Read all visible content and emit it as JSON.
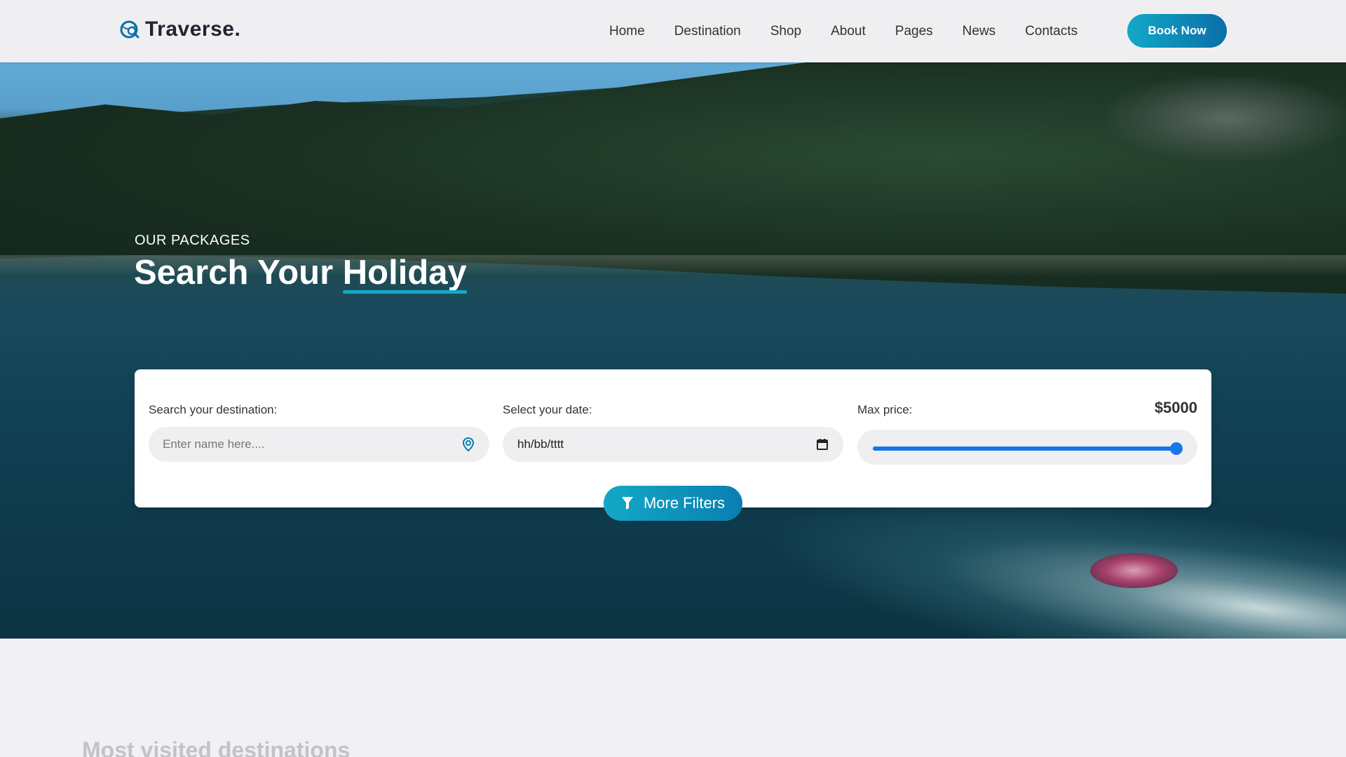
{
  "brand": {
    "name": "Traverse.",
    "icon": "globe-search-icon",
    "color": "#0a6fa9"
  },
  "nav": {
    "items": [
      {
        "label": "Home"
      },
      {
        "label": "Destination"
      },
      {
        "label": "Shop"
      },
      {
        "label": "About"
      },
      {
        "label": "Pages"
      },
      {
        "label": "News"
      },
      {
        "label": "Contacts"
      }
    ],
    "book_label": "Book Now"
  },
  "hero": {
    "eyebrow": "OUR PACKAGES",
    "title_prefix": "Search Your",
    "title_highlight": "Holiday",
    "background": "aerial-lake-forest-jetski-image"
  },
  "search": {
    "destination": {
      "label": "Search your destination:",
      "placeholder": "Enter name here....",
      "icon": "location-pin-icon"
    },
    "date": {
      "label": "Select your date:",
      "value": "hh/bb/tttt",
      "icon": "calendar-icon"
    },
    "price": {
      "label": "Max price:",
      "display": "$5000",
      "slider_fraction": 1.0
    },
    "more_filters_label": "More Filters",
    "more_filters_icon": "funnel-icon"
  },
  "next_section": {
    "title": "Most visited destinations"
  },
  "colors": {
    "accent": "#12a8c7",
    "accent_dark": "#0a6fa9",
    "slider": "#1976e8"
  }
}
